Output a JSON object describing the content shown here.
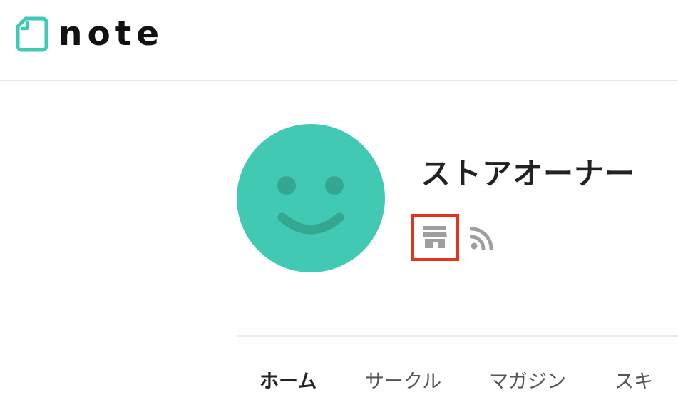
{
  "brand": {
    "name": "note",
    "accent_color": "#41c9b4"
  },
  "profile": {
    "name": "ストアオーナー",
    "avatar_icon": "smiley-face-icon",
    "avatar_color": "#41c9b4",
    "icons": [
      {
        "name": "store-icon",
        "highlighted": true,
        "highlight_color": "#e8331c"
      },
      {
        "name": "rss-icon",
        "highlighted": false
      }
    ],
    "icon_color": "#9e9e9e"
  },
  "tabs": [
    {
      "label": "ホーム",
      "active": true
    },
    {
      "label": "サークル",
      "active": false
    },
    {
      "label": "マガジン",
      "active": false
    },
    {
      "label": "スキ",
      "active": false
    }
  ]
}
